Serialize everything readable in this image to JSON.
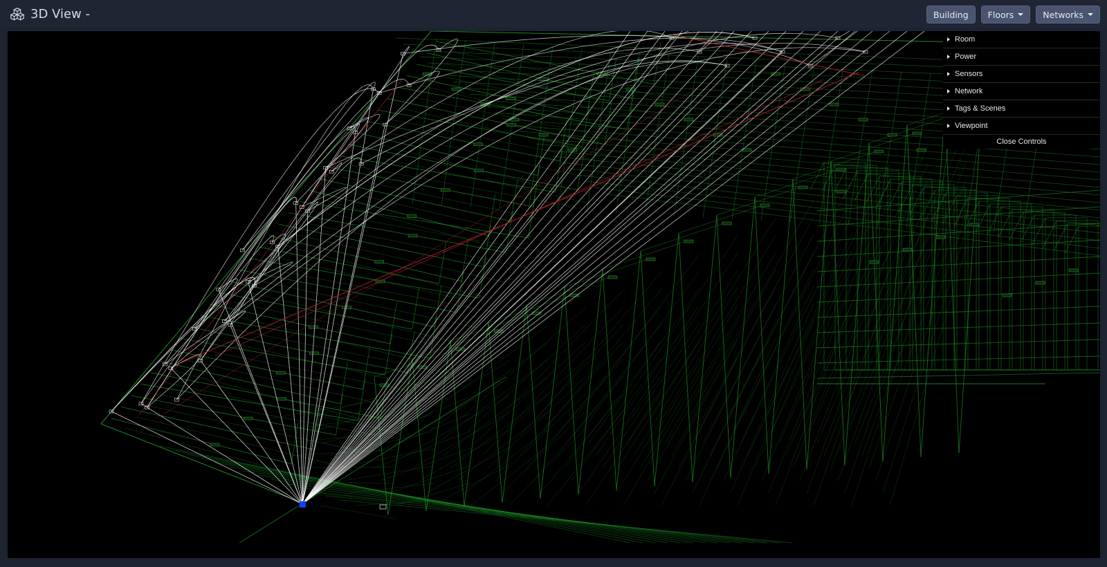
{
  "header": {
    "title": "3D View -",
    "buttons": {
      "building": "Building",
      "floors": "Floors",
      "networks": "Networks"
    }
  },
  "controls": {
    "items": [
      "Room",
      "Power",
      "Sensors",
      "Network",
      "Tags & Scenes",
      "Viewpoint"
    ],
    "close_label": "Close Controls"
  },
  "scene": {
    "room_outline_color": "#1f9b2a",
    "network_link_color": "#ffffff",
    "power_link_color": "#c0222a",
    "hub_color": "#1040ff"
  }
}
